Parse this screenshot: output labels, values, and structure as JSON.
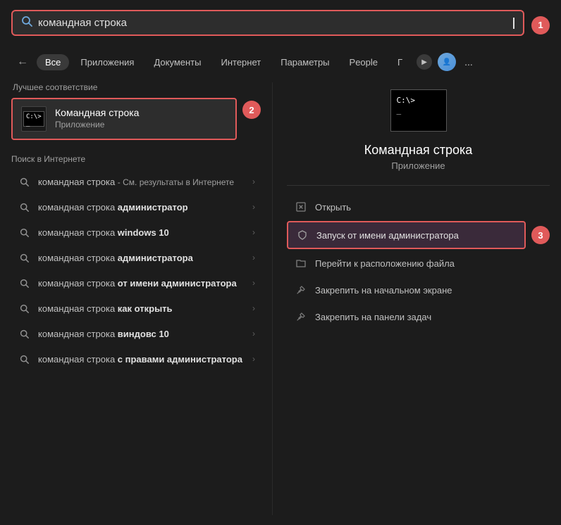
{
  "search": {
    "placeholder": "командная строка",
    "value": "командная строка"
  },
  "nav": {
    "back_icon": "←",
    "tabs": [
      {
        "label": "Все",
        "active": true
      },
      {
        "label": "Приложения",
        "active": false
      },
      {
        "label": "Документы",
        "active": false
      },
      {
        "label": "Интернет",
        "active": false
      },
      {
        "label": "Параметры",
        "active": false
      },
      {
        "label": "People",
        "active": false
      },
      {
        "label": "Г",
        "active": false
      }
    ],
    "more_label": "..."
  },
  "badges": {
    "b1": "1",
    "b2": "2",
    "b3": "3"
  },
  "best_match": {
    "section_label": "Лучшее соответствие",
    "title": "Командная строка",
    "subtitle": "Приложение"
  },
  "internet_search": {
    "section_label": "Поиск в Интернете",
    "items": [
      {
        "text": "командная строка",
        "suffix": " - См. результаты в Интернете",
        "bold_prefix": false
      },
      {
        "text": "командная строка ",
        "bold_part": "администратор",
        "suffix": ""
      },
      {
        "text": "командная строка ",
        "bold_part": "windows 10",
        "suffix": ""
      },
      {
        "text": "командная строка ",
        "bold_part": "администратора",
        "suffix": ""
      },
      {
        "text": "командная строка ",
        "bold_part": "от имени администратора",
        "suffix": ""
      },
      {
        "text": "командная строка ",
        "bold_part": "как открыть",
        "suffix": ""
      },
      {
        "text": "командная строка ",
        "bold_part": "виндовс 10",
        "suffix": ""
      },
      {
        "text": "командная строка ",
        "bold_part": "с правами администратора",
        "suffix": ""
      }
    ]
  },
  "right_panel": {
    "app_title": "Командная строка",
    "app_subtitle": "Приложение",
    "context_menu": [
      {
        "label": "Открыть",
        "icon": "↗"
      },
      {
        "label": "Запуск от имени администратора",
        "icon": "🛡",
        "highlighted": true
      },
      {
        "label": "Перейти к расположению файла",
        "icon": "📁"
      },
      {
        "label": "Закрепить на начальном экране",
        "icon": "📌"
      },
      {
        "label": "Закрепить на панели задач",
        "icon": "📌"
      }
    ]
  }
}
